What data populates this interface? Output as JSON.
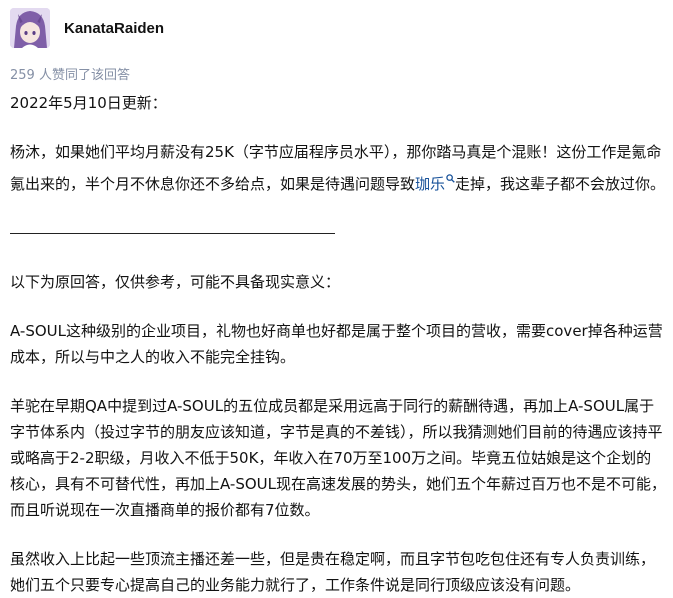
{
  "author": {
    "name": "KanataRaiden"
  },
  "vote_text": "259 人赞同了该回答",
  "update_line": "2022年5月10日更新：",
  "para1": {
    "before": "杨沐，如果她们平均月薪没有25K（字节应届程序员水平），那你踏马真是个混账！这份工作是氪命氪出来的，半个月不休息你还不多给点，如果是待遇问题导致",
    "keyword": "珈乐",
    "after": "走掉，我这辈子都不会放过你。"
  },
  "divider": "————————————————————",
  "intro": "以下为原回答，仅供参考，可能不具备现实意义：",
  "para2": "A-SOUL这种级别的企业项目，礼物也好商单也好都是属于整个项目的营收，需要cover掉各种运营成本，所以与中之人的收入不能完全挂钩。",
  "para3": "羊驼在早期QA中提到过A-SOUL的五位成员都是采用远高于同行的薪酬待遇，再加上A-SOUL属于字节体系内（投过字节的朋友应该知道，字节是真的不差钱），所以我猜测她们目前的待遇应该持平或略高于2-2职级，月收入不低于50K，年收入在70万至100万之间。毕竟五位姑娘是这个企划的核心，具有不可替代性，再加上A-SOUL现在高速发展的势头，她们五个年薪过百万也不是不可能，而且听说现在一次直播商单的报价都有7位数。",
  "para4": "虽然收入上比起一些顶流主播还差一些，但是贵在稳定啊，而且字节包吃包住还有专人负责训练，她们五个只要专心提高自己的业务能力就行了，工作条件说是同行顶级应该没有问题。",
  "colors": {
    "link": "#175199",
    "muted": "#8590a6",
    "text": "#121212"
  },
  "icons": {
    "keyword_search": "search-icon"
  }
}
